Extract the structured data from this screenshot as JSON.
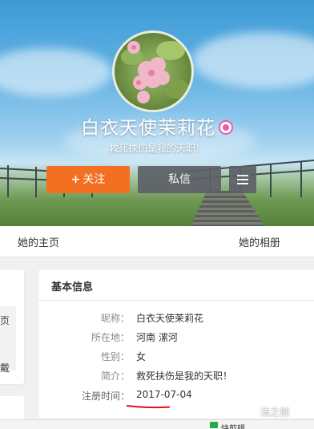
{
  "profile": {
    "nickname": "白衣天使茉莉花",
    "motto": "救死扶伤是我的天职！",
    "buttons": {
      "follow": "关注",
      "follow_prefix": "+",
      "message": "私信"
    }
  },
  "tabs": {
    "home": "她的主页",
    "album": "她的相册"
  },
  "left_card": {
    "text1": "页",
    "text2": "戴"
  },
  "info": {
    "title": "基本信息",
    "rows": [
      {
        "label": "昵称：",
        "value": "白衣天使茉莉花"
      },
      {
        "label": "所在地：",
        "value": "河南 漯河"
      },
      {
        "label": "性别：",
        "value": "女"
      },
      {
        "label": "简介：",
        "value": "救死扶伤是我的天职！"
      },
      {
        "label": "注册时间：",
        "value": "2017-07-04"
      }
    ]
  },
  "bottom": {
    "edit": "快剪辑"
  },
  "watermark": "法之剑",
  "colors": {
    "follow_button": "#f36f21",
    "secondary_button": "#5d6068",
    "highlight_underline": "#e0101a"
  }
}
